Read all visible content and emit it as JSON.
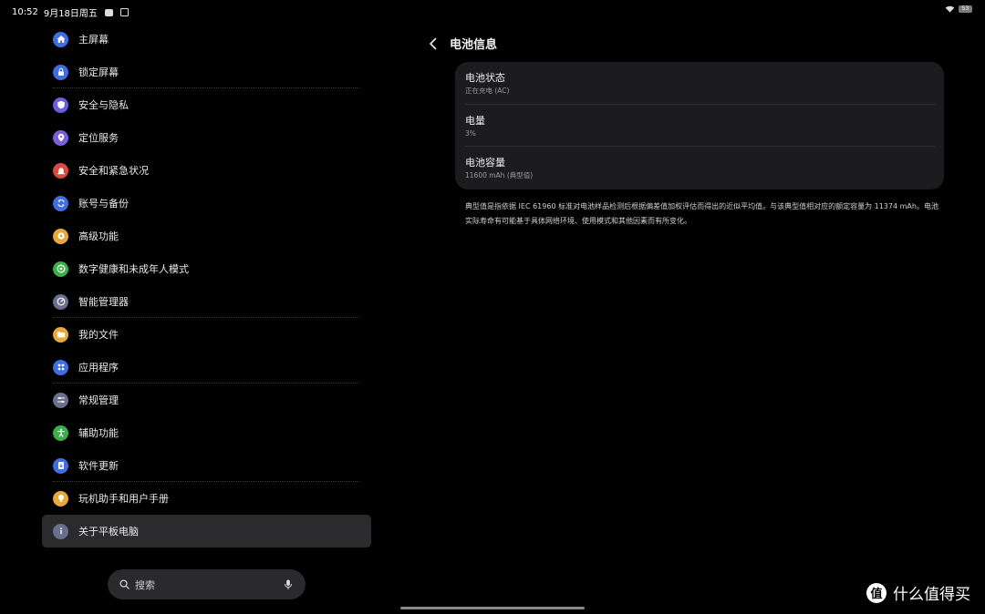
{
  "status_bar": {
    "time": "10:52",
    "date": "9月18日周五",
    "battery_level": "53"
  },
  "sidebar": {
    "items": [
      {
        "label": "主屏幕",
        "icon": "home-icon",
        "color": "#3f6ee0"
      },
      {
        "label": "锁定屏幕",
        "icon": "lock-icon",
        "color": "#3f6ee0"
      },
      {
        "label": "安全与隐私",
        "icon": "shield-icon",
        "color": "#6c5ce0"
      },
      {
        "label": "定位服务",
        "icon": "location-pin-icon",
        "color": "#7a5fd8"
      },
      {
        "label": "安全和紧急状况",
        "icon": "alarm-icon",
        "color": "#d94a43"
      },
      {
        "label": "账号与备份",
        "icon": "sync-icon",
        "color": "#3f6ee0"
      },
      {
        "label": "高级功能",
        "icon": "gear-star-icon",
        "color": "#e6a93a"
      },
      {
        "label": "数字健康和未成年人模式",
        "icon": "wellbeing-icon",
        "color": "#3fae4a"
      },
      {
        "label": "智能管理器",
        "icon": "gauge-icon",
        "color": "#6a6f8e"
      },
      {
        "label": "我的文件",
        "icon": "folder-icon",
        "color": "#e6a93a"
      },
      {
        "label": "应用程序",
        "icon": "apps-grid-icon",
        "color": "#3f6ee0"
      },
      {
        "label": "常规管理",
        "icon": "sliders-icon",
        "color": "#6a6f8e"
      },
      {
        "label": "辅助功能",
        "icon": "accessibility-icon",
        "color": "#3fae4a"
      },
      {
        "label": "软件更新",
        "icon": "update-icon",
        "color": "#3f6ee0"
      },
      {
        "label": "玩机助手和用户手册",
        "icon": "lightbulb-icon",
        "color": "#e6a93a"
      },
      {
        "label": "关于平板电脑",
        "icon": "info-icon",
        "color": "#6a6f8e"
      }
    ]
  },
  "search": {
    "placeholder": "搜索"
  },
  "detail": {
    "title": "电池信息",
    "rows": [
      {
        "title": "电池状态",
        "value": "正在充电 (AC)"
      },
      {
        "title": "电量",
        "value": "3%"
      },
      {
        "title": "电池容量",
        "value": "11600 mAh (典型值)"
      }
    ],
    "note": "典型值是指依据 IEC 61960 标准对电池样品检测后根据偏差值加权评估而得出的近似平均值。与该典型值相对应的额定容量为 11374 mAh。电池实际寿命有可能基于具体网络环境、使用模式和其他因素而有所变化。"
  },
  "watermark": {
    "logo": "值",
    "text": "什么值得买"
  }
}
